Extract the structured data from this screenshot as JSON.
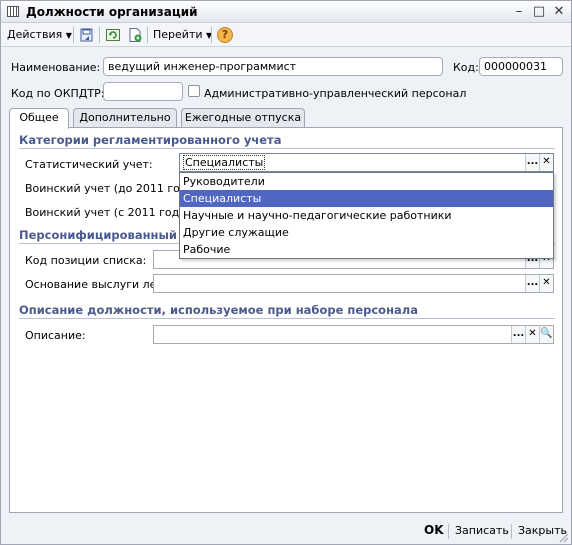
{
  "window": {
    "title": "Должности организаций"
  },
  "toolbar": {
    "actions_label": "Действия",
    "goto_label": "Перейти",
    "help_label": "?"
  },
  "form": {
    "name_label": "Наименование:",
    "name_value": "ведущий инженер-программист",
    "code_label": "Код:",
    "code_value": "000000031",
    "okpdtr_label": "Код по ОКПДТР:",
    "okpdtr_value": "",
    "admin_staff_label": "Административно-управленческий персонал",
    "admin_staff_checked": false
  },
  "tabs": [
    {
      "label": "Общее",
      "active": true
    },
    {
      "label": "Дополнительно",
      "active": false
    },
    {
      "label": "Ежегодные отпуска",
      "active": false
    }
  ],
  "general": {
    "categories_title": "Категории регламентированного учета",
    "stat_label": "Статистический учет:",
    "stat_value": "Специалисты",
    "military_old_label": "Воинский учет (до 2011 года):",
    "military_new_label": "Воинский учет (с 2011 года):",
    "personified_title": "Персонифицированный учет",
    "list_pos_label": "Код позиции списка:",
    "list_pos_value": "",
    "seniority_label": "Основание выслуги лет:",
    "seniority_value": "",
    "description_title": "Описание должности, используемое при наборе персонала",
    "description_label": "Описание:",
    "description_value": ""
  },
  "dropdown": {
    "items": [
      "Руководители",
      "Специалисты",
      "Научные и научно-педагогические работники",
      "Другие служащие",
      "Рабочие"
    ],
    "selected_index": 1
  },
  "footer": {
    "ok_label": "OK",
    "save_label": "Записать",
    "close_label": "Закрыть"
  },
  "colors": {
    "accent": "#4f67c2",
    "section_title": "#4b5a8e",
    "help_icon": "#e8a33a"
  }
}
